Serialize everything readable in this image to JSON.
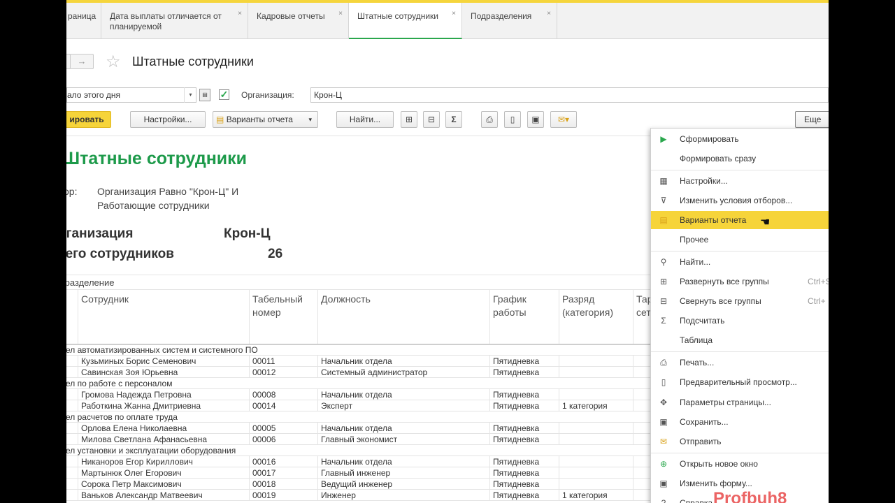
{
  "tabs": [
    {
      "label": "раница",
      "closable": false
    },
    {
      "label": "Дата выплаты отличается от планируемой",
      "closable": true
    },
    {
      "label": "Кадровые отчеты",
      "closable": true
    },
    {
      "label": "Штатные сотрудники",
      "closable": true,
      "active": true
    },
    {
      "label": "Подразделения",
      "closable": true
    }
  ],
  "icons": {
    "back": "←",
    "forward": "→",
    "star": "☆",
    "dropdown": "▾",
    "calendar": "▤",
    "check": "✓",
    "close": "×",
    "play": "▶",
    "sum": "Σ",
    "pointer": "☚"
  },
  "page": {
    "title": "Штатные сотрудники"
  },
  "filters": {
    "period_value": "ало этого дня",
    "use_org": true,
    "org_label": "Организация:",
    "org_value": "Крон-Ц"
  },
  "toolbar": {
    "generate": "ировать",
    "settings": "Настройки...",
    "variants": "Варианты отчета",
    "find": "Найти...",
    "more": "Еще"
  },
  "report": {
    "title": "Штатные сотрудники",
    "filter_label": "бор:",
    "filter_line1": "Организация Равно \"Крон-Ц\" И",
    "filter_line2": "Работающие сотрудники",
    "org_label": "рганизация",
    "org_value": "Крон-Ц",
    "total_label": "сего сотрудников",
    "total_value": "26",
    "group_header": "дразделение",
    "columns": [
      "Сотрудник",
      "Табельный номер",
      "Должность",
      "График работы",
      "Разряд (категория)",
      "Тар сет"
    ],
    "rows": [
      {
        "type": "group",
        "text": "ел автоматизированных систем и системного ПО"
      },
      {
        "type": "row",
        "cells": [
          "Кузьминых Борис Семенович",
          "00011",
          "Начальник отдела",
          "Пятидневка",
          "",
          ""
        ]
      },
      {
        "type": "row",
        "cells": [
          "Савинская Зоя Юрьевна",
          "00012",
          "Системный администратор",
          "Пятидневка",
          "",
          ""
        ]
      },
      {
        "type": "group",
        "text": "ел по работе с персоналом"
      },
      {
        "type": "row",
        "cells": [
          "Громова Надежда Петровна",
          "00008",
          "Начальник отдела",
          "Пятидневка",
          "",
          ""
        ]
      },
      {
        "type": "row",
        "cells": [
          "Работкина Жанна Дмитриевна",
          "00014",
          "Эксперт",
          "Пятидневка",
          "1 категория",
          ""
        ]
      },
      {
        "type": "group",
        "text": "ел расчетов по оплате труда"
      },
      {
        "type": "row",
        "cells": [
          "Орлова Елена Николаевна",
          "00005",
          "Начальник отдела",
          "Пятидневка",
          "",
          ""
        ]
      },
      {
        "type": "row",
        "cells": [
          "Милова Светлана Афанасьевна",
          "00006",
          "Главный экономист",
          "Пятидневка",
          "",
          ""
        ]
      },
      {
        "type": "group",
        "text": "ел установки и эксплуатации оборудования"
      },
      {
        "type": "row",
        "cells": [
          "Никаноров Егор Кириллович",
          "00016",
          "Начальник отдела",
          "Пятидневка",
          "",
          ""
        ]
      },
      {
        "type": "row",
        "cells": [
          "Мартынюк Олег Егорович",
          "00017",
          "Главный инженер",
          "Пятидневка",
          "",
          ""
        ]
      },
      {
        "type": "row",
        "cells": [
          "Сорока Петр Максимович",
          "00018",
          "Ведущий инженер",
          "Пятидневка",
          "",
          ""
        ]
      },
      {
        "type": "row",
        "cells": [
          "Ваньков Александр Матвеевич",
          "00019",
          "Инженер",
          "Пятидневка",
          "1 категория",
          ""
        ]
      }
    ]
  },
  "menu": {
    "items": [
      {
        "label": "Сформировать",
        "icon": "play-icon",
        "glyph": "▶",
        "key": ""
      },
      {
        "label": "Формировать сразу",
        "icon": "",
        "glyph": "",
        "key": ""
      },
      {
        "label": "Настройки...",
        "icon": "settings-icon",
        "glyph": "▦",
        "key": ""
      },
      {
        "label": "Изменить условия отборов...",
        "icon": "filter-icon",
        "glyph": "⊽",
        "key": ""
      },
      {
        "label": "Варианты отчета",
        "icon": "report-variants-icon",
        "glyph": "▤",
        "key": "",
        "highlighted": true
      },
      {
        "label": "Прочее",
        "icon": "",
        "glyph": "",
        "key": ""
      },
      {
        "label": "Найти...",
        "icon": "search-icon",
        "glyph": "⚲",
        "key": ""
      },
      {
        "label": "Развернуть все группы",
        "icon": "expand-groups-icon",
        "glyph": "⊞",
        "key": "Ctrl+S"
      },
      {
        "label": "Свернуть все группы",
        "icon": "collapse-groups-icon",
        "glyph": "⊟",
        "key": "Ctrl+"
      },
      {
        "label": "Подсчитать",
        "icon": "sum-icon",
        "glyph": "Σ",
        "key": ""
      },
      {
        "label": "Таблица",
        "icon": "",
        "glyph": "",
        "key": ""
      },
      {
        "label": "Печать...",
        "icon": "print-icon",
        "glyph": "⎙",
        "key": ""
      },
      {
        "label": "Предварительный просмотр...",
        "icon": "preview-icon",
        "glyph": "▯",
        "key": ""
      },
      {
        "label": "Параметры страницы...",
        "icon": "page-settings-icon",
        "glyph": "✥",
        "key": ""
      },
      {
        "label": "Сохранить...",
        "icon": "save-icon",
        "glyph": "▣",
        "key": ""
      },
      {
        "label": "Отправить",
        "icon": "mail-icon",
        "glyph": "✉",
        "key": ""
      },
      {
        "label": "Открыть новое окно",
        "icon": "new-window-icon",
        "glyph": "⊕",
        "key": ""
      },
      {
        "label": "Изменить форму...",
        "icon": "edit-form-icon",
        "glyph": "▣",
        "key": ""
      },
      {
        "label": "Справка",
        "icon": "help-icon",
        "glyph": "?",
        "key": ""
      }
    ]
  },
  "watermark": "Profbuh8",
  "colors": {
    "accent_yellow": "#f6d43a",
    "title_green": "#1d9a4a",
    "tab_active_underline": "#2aa74d"
  }
}
